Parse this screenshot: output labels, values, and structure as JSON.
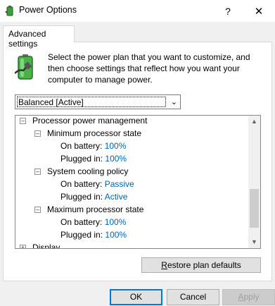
{
  "window": {
    "title": "Power Options",
    "help_glyph": "?",
    "close_glyph": "✕",
    "icon": "power-options-icon"
  },
  "tab": {
    "label": "Advanced settings"
  },
  "description": "Select the power plan that you want to customize, and then choose settings that reflect how you want your computer to manage power.",
  "plan_select": {
    "value": "Balanced [Active]"
  },
  "tree": {
    "partial_top": "Processor power management",
    "groups": [
      {
        "label": "Minimum processor state",
        "settings": [
          {
            "label": "On battery:",
            "value": "100%"
          },
          {
            "label": "Plugged in:",
            "value": "100%"
          }
        ]
      },
      {
        "label": "System cooling policy",
        "settings": [
          {
            "label": "On battery:",
            "value": "Passive"
          },
          {
            "label": "Plugged in:",
            "value": "Active"
          }
        ]
      },
      {
        "label": "Maximum processor state",
        "settings": [
          {
            "label": "On battery:",
            "value": "100%"
          },
          {
            "label": "Plugged in:",
            "value": "100%"
          }
        ]
      }
    ],
    "partial_bottom": "Display"
  },
  "buttons": {
    "restore_first": "R",
    "restore_rest": "estore plan defaults",
    "ok": "OK",
    "cancel": "Cancel",
    "apply_first": "A",
    "apply_rest": "pply"
  }
}
